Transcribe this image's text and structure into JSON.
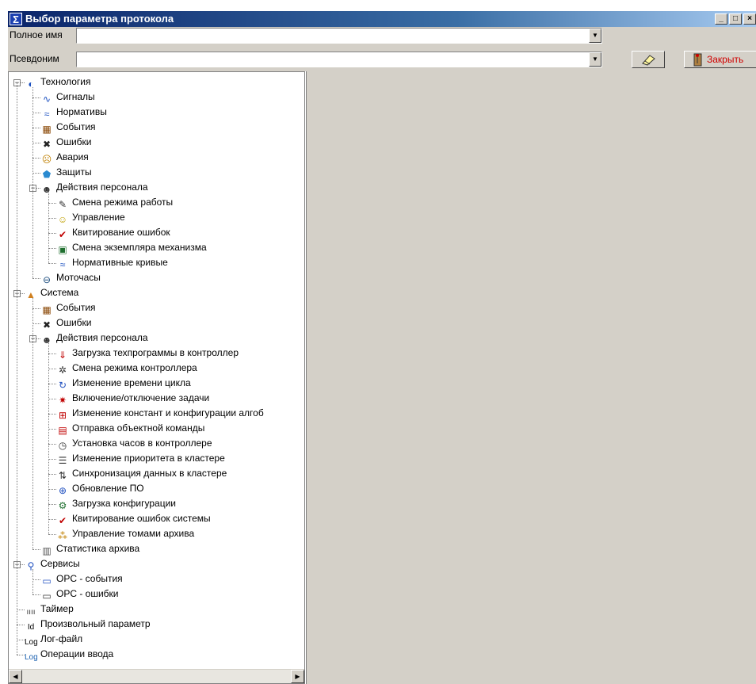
{
  "window": {
    "title": "Выбор параметра протокола"
  },
  "form": {
    "full_name_label": "Полное имя",
    "full_name_value": "",
    "alias_label": "Псевдоним",
    "alias_value": "",
    "close_label": "Закрыть"
  },
  "tree": [
    {
      "label": "Технология",
      "icon": "technology-icon",
      "level": 0,
      "expanded": true
    },
    {
      "label": "Сигналы",
      "icon": "signal-wave-icon",
      "level": 1
    },
    {
      "label": "Нормативы",
      "icon": "normative-curve-icon",
      "level": 1
    },
    {
      "label": "События",
      "icon": "events-icon",
      "level": 1
    },
    {
      "label": "Ошибки",
      "icon": "errors-icon",
      "level": 1
    },
    {
      "label": "Авария",
      "icon": "alarm-face-icon",
      "level": 1
    },
    {
      "label": "Защиты",
      "icon": "shield-icon",
      "level": 1
    },
    {
      "label": "Действия персонала",
      "icon": "personnel-icon",
      "level": 1,
      "expanded": true
    },
    {
      "label": "Смена режима работы",
      "icon": "mode-change-icon",
      "level": 2
    },
    {
      "label": "Управление",
      "icon": "control-face-icon",
      "level": 2
    },
    {
      "label": "Квитирование ошибок",
      "icon": "acknowledge-icon",
      "level": 2
    },
    {
      "label": "Смена экземпляра механизма",
      "icon": "mechanism-instance-icon",
      "level": 2
    },
    {
      "label": "Нормативные кривые",
      "icon": "normative-curve-icon",
      "level": 2
    },
    {
      "label": "Моточасы",
      "icon": "motor-hours-icon",
      "level": 1
    },
    {
      "label": "Система",
      "icon": "system-icon",
      "level": 0,
      "expanded": true
    },
    {
      "label": "События",
      "icon": "events-icon",
      "level": 1
    },
    {
      "label": "Ошибки",
      "icon": "errors-icon",
      "level": 1
    },
    {
      "label": "Действия персонала",
      "icon": "personnel-icon",
      "level": 1,
      "expanded": true
    },
    {
      "label": "Загрузка техпрограммы в контроллер",
      "icon": "program-load-icon",
      "level": 2
    },
    {
      "label": "Смена режима контроллера",
      "icon": "controller-mode-icon",
      "level": 2
    },
    {
      "label": "Изменение времени цикла",
      "icon": "cycle-time-icon",
      "level": 2
    },
    {
      "label": "Включение/отключение задачи",
      "icon": "task-toggle-icon",
      "level": 2
    },
    {
      "label": "Изменение констант и конфигурации алгоб",
      "icon": "constants-icon",
      "level": 2
    },
    {
      "label": "Отправка объектной команды",
      "icon": "object-command-icon",
      "level": 2
    },
    {
      "label": "Установка часов в контроллере",
      "icon": "clock-icon",
      "level": 2
    },
    {
      "label": "Изменение приоритета в кластере",
      "icon": "cluster-priority-icon",
      "level": 2
    },
    {
      "label": "Синхронизация данных в кластере",
      "icon": "cluster-sync-icon",
      "level": 2
    },
    {
      "label": "Обновление ПО",
      "icon": "software-update-icon",
      "level": 2
    },
    {
      "label": "Загрузка конфигурации",
      "icon": "config-load-icon",
      "level": 2
    },
    {
      "label": "Квитирование ошибок системы",
      "icon": "acknowledge-icon",
      "level": 2
    },
    {
      "label": "Управление томами архива",
      "icon": "archive-volumes-icon",
      "level": 2
    },
    {
      "label": "Статистика архива",
      "icon": "archive-stats-icon",
      "level": 1
    },
    {
      "label": "Сервисы",
      "icon": "services-icon",
      "level": 0,
      "expanded": true
    },
    {
      "label": "OPC - события",
      "icon": "opc-events-icon",
      "level": 1
    },
    {
      "label": "OPC - ошибки",
      "icon": "opc-errors-icon",
      "level": 1
    },
    {
      "label": "Таймер",
      "icon": "timer-icon",
      "level": 0
    },
    {
      "label": "Произвольный параметр",
      "icon": "custom-param-icon",
      "level": 0
    },
    {
      "label": "Лог-файл",
      "icon": "log-file-icon",
      "level": 0
    },
    {
      "label": "Операции ввода",
      "icon": "input-operations-icon",
      "level": 0
    }
  ]
}
